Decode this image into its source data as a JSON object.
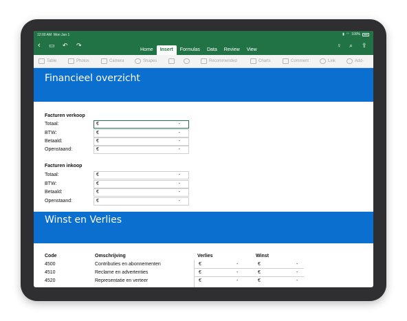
{
  "status": {
    "time": "12:00 AM",
    "date": "Mon Jan 1",
    "battery": "100%"
  },
  "nav": {
    "tabs": [
      {
        "label": "Home",
        "active": false
      },
      {
        "label": "Insert",
        "active": true
      },
      {
        "label": "Formulas",
        "active": false
      },
      {
        "label": "Data",
        "active": false
      },
      {
        "label": "Review",
        "active": false
      },
      {
        "label": "View",
        "active": false
      }
    ]
  },
  "ribbon": {
    "items": [
      "Table",
      "Photos",
      "Camera",
      "Shapes",
      "Recommended",
      "Charts",
      "Comment",
      "Link",
      "Add-"
    ]
  },
  "sections": {
    "financieel_title": "Financieel overzicht",
    "winst_title": "Winst en Verlies"
  },
  "verkoop": {
    "header": "Facturen verkoop",
    "rows": [
      {
        "label": "Totaal:",
        "currency": "€",
        "value": "-"
      },
      {
        "label": "BTW:",
        "currency": "€",
        "value": "-"
      },
      {
        "label": "Betaald:",
        "currency": "€",
        "value": "-"
      },
      {
        "label": "Openstaand:",
        "currency": "€",
        "value": "-"
      }
    ]
  },
  "inkoop": {
    "header": "Facturen inkoop",
    "rows": [
      {
        "label": "Totaal:",
        "currency": "€",
        "value": "-"
      },
      {
        "label": "BTW:",
        "currency": "€",
        "value": "-"
      },
      {
        "label": "Betaald:",
        "currency": "€",
        "value": "-"
      },
      {
        "label": "Openstaand:",
        "currency": "€",
        "value": "-"
      }
    ]
  },
  "wv_table": {
    "headers": [
      "Code",
      "Omschrijving",
      "Verlies",
      "Winst"
    ],
    "rows": [
      {
        "code": "4500",
        "desc": "Contributies en abonnementen",
        "v_cur": "€",
        "v_val": "-",
        "w_cur": "€",
        "w_val": "-"
      },
      {
        "code": "4510",
        "desc": "Reclame en advertenties",
        "v_cur": "€",
        "v_val": "-",
        "w_cur": "€",
        "w_val": "-"
      },
      {
        "code": "4520",
        "desc": "Representatie en verteer",
        "v_cur": "€",
        "v_val": "-",
        "w_cur": "€",
        "w_val": "-"
      }
    ]
  }
}
